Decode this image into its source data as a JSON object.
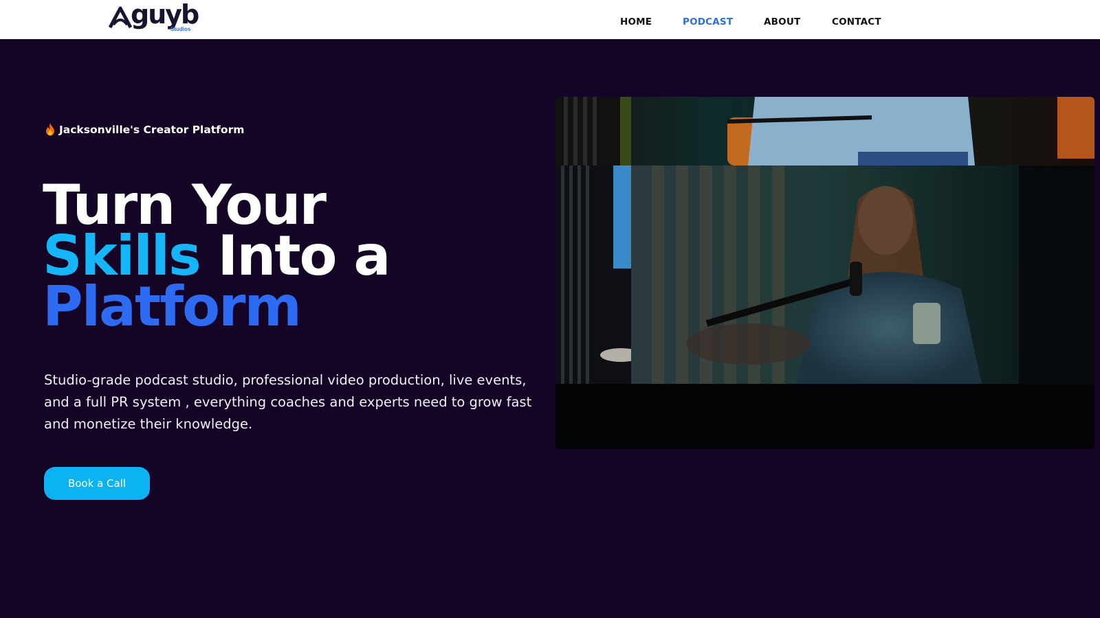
{
  "brand": {
    "name": "guyb",
    "sub": "Studios",
    "colors": {
      "wordmark": "#1a1330",
      "sub": "#2b6de0"
    }
  },
  "nav": {
    "items": [
      {
        "label": "HOME",
        "active": false
      },
      {
        "label": "PODCAST",
        "active": true
      },
      {
        "label": "ABOUT",
        "active": false
      },
      {
        "label": "CONTACT",
        "active": false
      }
    ]
  },
  "hero": {
    "eyebrow_icon": "fire-icon",
    "eyebrow": "Jacksonville's  Creator Platform",
    "headline": {
      "line1": "Turn Your",
      "line2_highlight": "Skills",
      "line2_rest": " Into a",
      "line3": "Platform"
    },
    "description": "Studio-grade podcast studio, professional video production, live events, and a full PR system , everything coaches and experts need to grow fast and monetize their knowledge.",
    "cta_label": "Book a Call"
  },
  "colors": {
    "background": "#140425",
    "accent_cyan": "#15b6f8",
    "accent_blue": "#2d6bf3",
    "nav_active": "#2e6fe0",
    "button": "#0bb3f3"
  }
}
